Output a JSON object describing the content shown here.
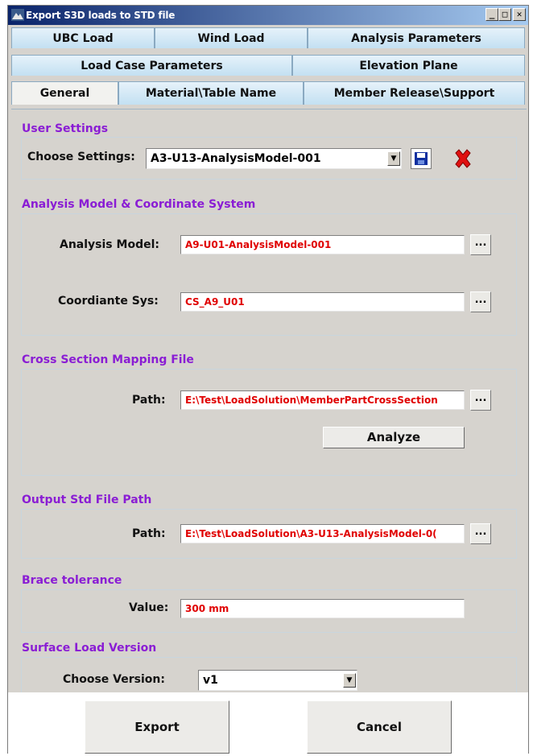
{
  "window": {
    "title": "Export S3D loads to STD file"
  },
  "tabs": {
    "row1": [
      "UBC Load",
      "Wind Load",
      "Analysis Parameters"
    ],
    "row2": [
      "Load Case Parameters",
      "Elevation Plane"
    ],
    "row3": [
      "General",
      "Material\\Table Name",
      "Member Release\\Support"
    ],
    "active": "General"
  },
  "user_settings": {
    "title": "User Settings",
    "label": "Choose Settings:",
    "value": "A3-U13-AnalysisModel-001"
  },
  "analysis": {
    "title": "Analysis Model & Coordinate System",
    "model_label": "Analysis Model:",
    "model_value": "A9-U01-AnalysisModel-001",
    "coord_label": "Coordiante Sys:",
    "coord_value": "CS_A9_U01"
  },
  "cross_section": {
    "title": "Cross Section Mapping File",
    "path_label": "Path:",
    "path_value": "E:\\Test\\LoadSolution\\MemberPartCrossSection",
    "analyze_label": "Analyze"
  },
  "output": {
    "title": "Output Std File Path",
    "path_label": "Path:",
    "path_value": "E:\\Test\\LoadSolution\\A3-U13-AnalysisModel-0("
  },
  "brace": {
    "title": "Brace tolerance",
    "value_label": "Value:",
    "value": "300 mm"
  },
  "surface": {
    "title": "Surface Load Version",
    "label": "Choose Version:",
    "value": "v1"
  },
  "browse_label": "...",
  "footer": {
    "export_label": "Export",
    "cancel_label": "Cancel"
  },
  "colors": {
    "section_title": "#8a1dd4",
    "field_text": "#e00000",
    "tab_bg": "#c3e0f2"
  }
}
